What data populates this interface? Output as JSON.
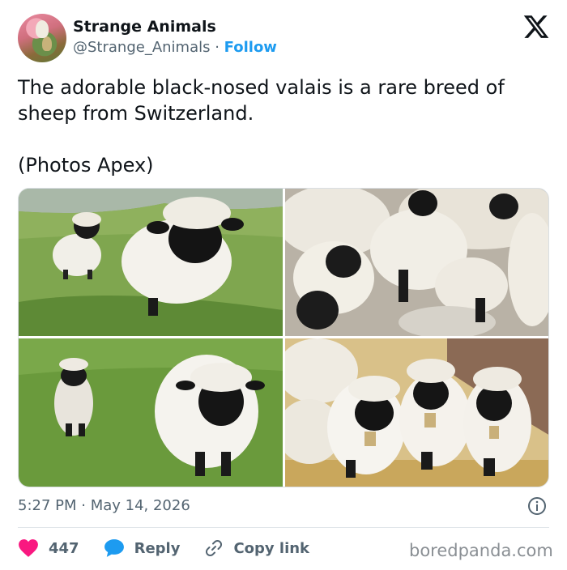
{
  "account": {
    "display_name": "Strange Animals",
    "handle": "@Strange_Animals",
    "separator": " · ",
    "follow_label": "Follow"
  },
  "platform_icon": "x-logo-icon",
  "tweet": {
    "text": "The adorable black-nosed valais is a rare breed of\nsheep from Switzerland.\n\n(Photos Apex)"
  },
  "photos": [
    {
      "subject": "two black-nosed sheep on a mountain meadow"
    },
    {
      "subject": "flock of black-nosed sheep on rocks"
    },
    {
      "subject": "lamb and adult black-nosed sheep on grass"
    },
    {
      "subject": "three black-nosed sheep with bells on straw"
    }
  ],
  "timestamp": "5:27 PM · May 14, 2026",
  "info_icon": "info-icon",
  "actions": {
    "like_count": "447",
    "reply_label": "Reply",
    "copy_link_label": "Copy link"
  },
  "colors": {
    "link_blue": "#1d9bf0",
    "heart_red": "#f91880",
    "reply_blue": "#1d9bf0",
    "muted_text": "#536471"
  },
  "watermark": "boredpanda.com"
}
